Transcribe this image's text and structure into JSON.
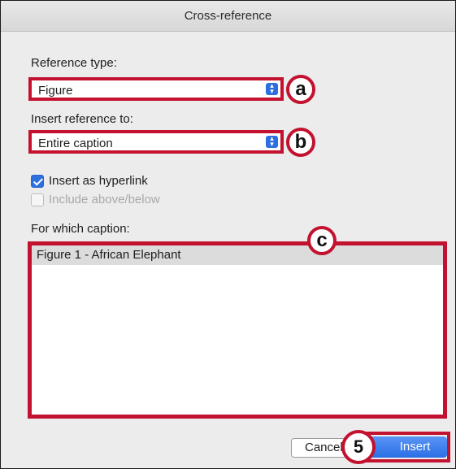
{
  "dialog": {
    "title": "Cross-reference",
    "reference_type_label": "Reference type:",
    "reference_type_value": "Figure",
    "insert_reference_label": "Insert reference to:",
    "insert_reference_value": "Entire caption",
    "insert_hyperlink_label": "Insert as hyperlink",
    "insert_hyperlink_checked": true,
    "include_above_below_label": "Include above/below",
    "include_above_below_checked": false,
    "for_which_caption_label": "For which caption:",
    "captions": [
      "Figure 1 - African Elephant"
    ],
    "cancel_label": "Cancel",
    "insert_label": "Insert"
  },
  "annotations": {
    "a": "a",
    "b": "b",
    "c": "c",
    "step": "5"
  },
  "colors": {
    "highlight_border": "#c3122f",
    "accent_blue": "#2e6fe0"
  }
}
